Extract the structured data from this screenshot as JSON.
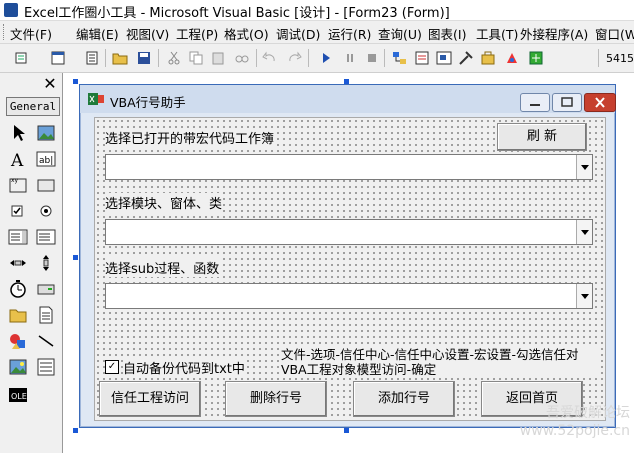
{
  "window": {
    "title": "Excel工作圈小工具 - Microsoft Visual Basic [设计] - [Form23 (Form)]"
  },
  "menu": {
    "items": [
      "文件(F)",
      "编辑(E)",
      "视图(V)",
      "工程(P)",
      "格式(O)",
      "调试(D)",
      "运行(R)",
      "查询(U)",
      "图表(I)",
      "工具(T)",
      "外接程序(A)",
      "窗口(W"
    ]
  },
  "toolbar": {
    "coordinates": "5415"
  },
  "toolbox": {
    "tab_label": "General",
    "close_label": "✕"
  },
  "form": {
    "title": "VBA行号助手",
    "label_workbook": "选择已打开的带宏代码工作簿",
    "refresh_button": "刷 新",
    "label_module": "选择模块、窗体、类",
    "label_sub": "选择sub过程、函数",
    "checkbox_backup": "自动备份代码到txt中",
    "checkbox_mark": "✓",
    "note": "文件-选项-信任中心-信任中心设置-宏设置-勾选信任对VBA工程对象模型访问-确定",
    "buttons": {
      "trust": "信任工程访问",
      "delete": "删除行号",
      "add": "添加行号",
      "home": "返回首页"
    }
  },
  "watermark": {
    "line1": "吾爱破解论坛",
    "line2": "www.52pojie.cn"
  }
}
